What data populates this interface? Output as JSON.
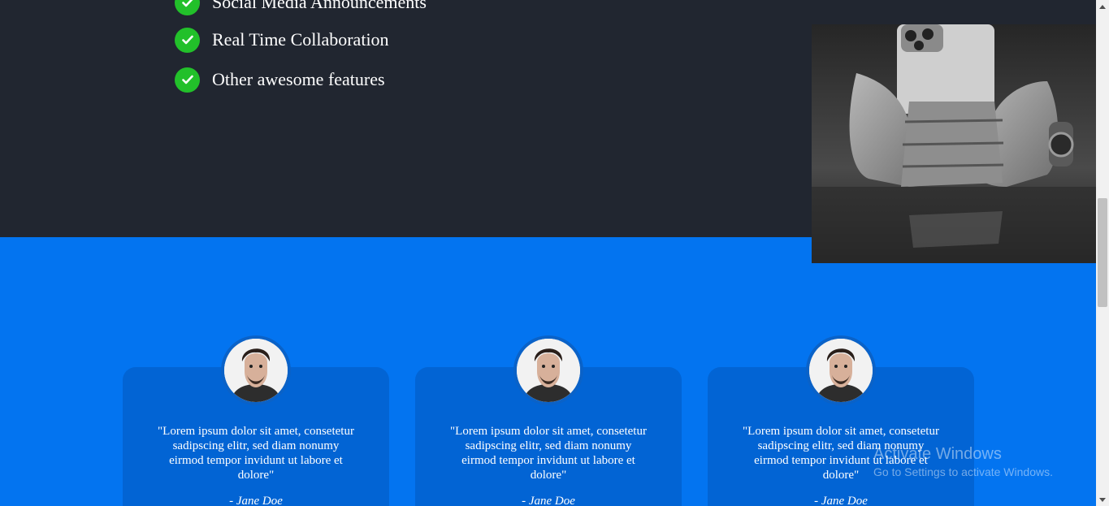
{
  "features": {
    "items": [
      {
        "label": "Social Media Announcements",
        "icon": "check-circle-icon"
      },
      {
        "label": "Real Time Collaboration",
        "icon": "check-circle-icon"
      },
      {
        "label": "Other awesome features",
        "icon": "check-circle-icon"
      }
    ]
  },
  "showcase": {
    "image": "hands-holding-phone-photo"
  },
  "testimonials": [
    {
      "quote": "\"Lorem ipsum dolor sit amet, consetetur sadipscing elitr, sed diam nonumy eirmod tempor invidunt ut labore et dolore\"",
      "author": "- Jane Doe"
    },
    {
      "quote": "\"Lorem ipsum dolor sit amet, consetetur sadipscing elitr, sed diam nonumy eirmod tempor invidunt ut labore et dolore\"",
      "author": "- Jane Doe"
    },
    {
      "quote": "\"Lorem ipsum dolor sit amet, consetetur sadipscing elitr, sed diam nonumy eirmod tempor invidunt ut labore et dolore\"",
      "author": "- Jane Doe"
    }
  ],
  "watermark": {
    "title": "Activate Windows",
    "subtitle": "Go to Settings to activate Windows."
  },
  "colors": {
    "dark_bg": "#212630",
    "blue_bg": "#0374f0",
    "card_bg": "#0264d4",
    "check": "#22c02a"
  }
}
